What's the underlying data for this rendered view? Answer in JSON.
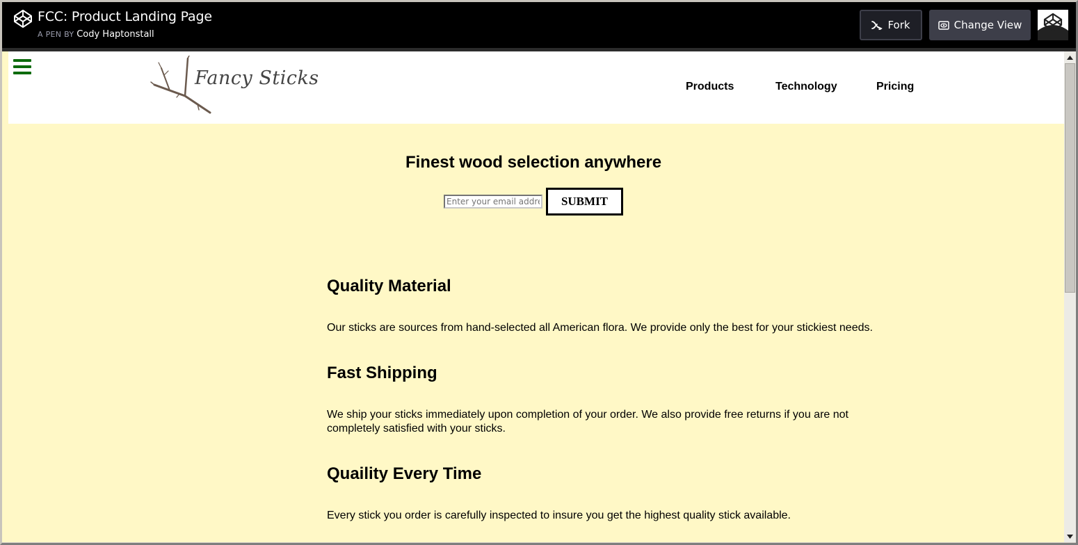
{
  "codepen": {
    "title": "FCC: Product Landing Page",
    "byline_prefix": "A PEN BY",
    "author": "Cody Haptonstall",
    "fork_label": "Fork",
    "change_view_label": "Change View"
  },
  "site": {
    "logo_text": "Fancy Sticks",
    "nav": [
      "Products",
      "Technology",
      "Pricing"
    ],
    "hero_title": "Finest wood selection anywhere",
    "email_placeholder": "Enter your email address",
    "submit_label": "SUBMIT",
    "features": [
      {
        "title": "Quality Material",
        "text": "Our sticks are sources from hand-selected all American flora. We provide only the best for your stickiest needs."
      },
      {
        "title": "Fast Shipping",
        "text": "We ship your sticks immediately upon completion of your order. We also provide free returns if you are not completely satisfied with your sticks."
      },
      {
        "title": "Quaility Every Time",
        "text": "Every stick you order is carefully inspected to insure you get the highest quality stick available."
      }
    ]
  },
  "colors": {
    "page_bg": "#fff8c6",
    "hamburger": "#0d6b0d",
    "codepen_bar": "#000000"
  }
}
